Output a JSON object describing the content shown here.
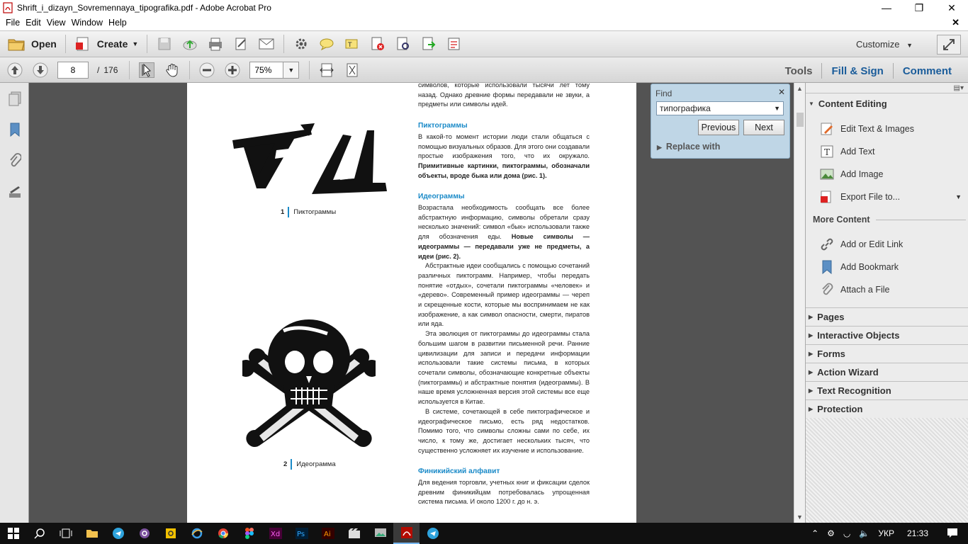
{
  "window": {
    "title": "Shrift_i_dizayn_Sovremennaya_tipografika.pdf - Adobe Acrobat Pro"
  },
  "menu": [
    "File",
    "Edit",
    "View",
    "Window",
    "Help"
  ],
  "toolbar": {
    "open_label": "Open",
    "create_label": "Create",
    "customize_label": "Customize"
  },
  "nav": {
    "current_page": "8",
    "page_sep": "/",
    "total_pages": "176",
    "zoom": "75%"
  },
  "right_links": [
    "Tools",
    "Fill & Sign",
    "Comment"
  ],
  "find": {
    "label": "Find",
    "query": "типографика",
    "previous_label": "Previous",
    "next_label": "Next",
    "replace_label": "Replace with"
  },
  "document": {
    "fig1_num": "1",
    "fig1_caption": "Пиктограммы",
    "fig2_num": "2",
    "fig2_caption": "Идеограмма",
    "p0": "символов, которые использовали тысячи лет тому назад. Однако древние формы передавали не звуки, а предметы или символы идей.",
    "h1": "Пиктограммы",
    "p1": "В какой-то момент истории люди стали общаться с помощью визуальных образов. Для этого они создавали простые изображения того, что их окружало.",
    "p1b": "Примитивные картинки, пиктограммы, обозначали объекты, вроде быка или дома (рис. 1).",
    "h2": "Идеограммы",
    "p2": "Возрастала необходимость сообщать все более абстрактную информацию, символы обретали сразу несколько значений: символ «бык» использовали также для обозначения еды.",
    "p2b": "Новые символы — идеограммы — передавали уже не предметы, а идеи (рис. 2).",
    "p3": "Абстрактные идеи сообщались с помощью сочетаний различных пиктограмм. Например, чтобы передать понятие «отдых», сочетали пиктограммы «человек» и «дерево». Современный пример идеограммы — череп и скрещенные кости, которые мы воспринимаем не как изображение, а как символ опасности, смерти, пиратов или яда.",
    "p4": "Эта эволюция от пиктограммы до идеограммы стала большим шагом в развитии письменной речи. Ранние цивилизации для записи и передачи информации использовали такие системы письма, в которых сочетали символы, обозначающие конкретные объекты (пиктограммы) и абстрактные понятия (идеограммы). В наше время усложненная версия этой системы все еще используется в Китае.",
    "p5": "В системе, сочетающей в себе пиктографическое и идеографическое письмо, есть ряд недостатков. Помимо того, что символы сложны сами по себе, их число, к тому же, достигает нескольких тысяч, что существенно усложняет их изучение и использование.",
    "h3": "Финикийский алфавит",
    "p6": "Для ведения торговли, учетных книг и фиксации сделок древним финикийцам потребовалась упрощенная система письма. И около 1200 г. до н. э."
  },
  "panel": {
    "content_editing": "Content Editing",
    "items": [
      "Edit Text & Images",
      "Add Text",
      "Add Image",
      "Export File to..."
    ],
    "more_content": "More Content",
    "more_items": [
      "Add or Edit Link",
      "Add Bookmark",
      "Attach a File"
    ],
    "sections": [
      "Pages",
      "Interactive Objects",
      "Forms",
      "Action Wizard",
      "Text Recognition",
      "Protection"
    ]
  },
  "taskbar": {
    "lang": "УКР",
    "time": "21:33"
  },
  "colors": {
    "accent_blue": "#1a8ac8",
    "find_bg": "#bfd6e6",
    "doc_bg": "#535353"
  }
}
